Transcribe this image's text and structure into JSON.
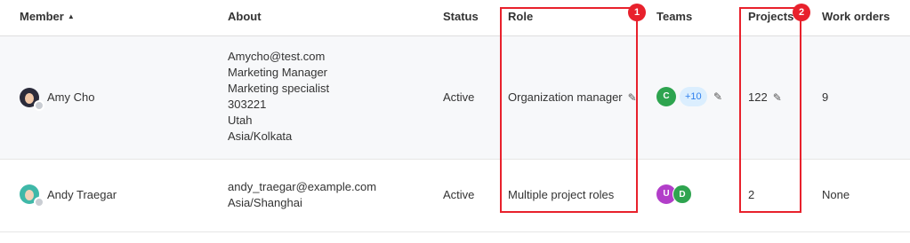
{
  "columns": {
    "member": "Member",
    "about": "About",
    "status": "Status",
    "role": "Role",
    "teams": "Teams",
    "projects": "Projects",
    "work_orders": "Work orders"
  },
  "sort_indicator": "▲",
  "rows": [
    {
      "name": "Amy Cho",
      "about": [
        "Amycho@test.com",
        "Marketing Manager",
        "Marketing specialist",
        "303221",
        "Utah",
        "Asia/Kolkata"
      ],
      "status": "Active",
      "role": "Organization manager",
      "teams": [
        {
          "letter": "C",
          "color": "#2ea44f"
        }
      ],
      "teams_more": "+10",
      "projects": "122",
      "work_orders": "9"
    },
    {
      "name": "Andy Traegar",
      "about": [
        "andy_traegar@example.com",
        "Asia/Shanghai"
      ],
      "status": "Active",
      "role": "Multiple project roles",
      "teams": [
        {
          "letter": "U",
          "color": "#b23ec9"
        },
        {
          "letter": "D",
          "color": "#2ea44f"
        }
      ],
      "projects": "2",
      "work_orders": "None"
    }
  ],
  "highlights": [
    {
      "number": "1",
      "color": "#e8212c"
    },
    {
      "number": "2",
      "color": "#e8212c"
    }
  ],
  "icons": {
    "edit": "pencil-icon",
    "sort": "sort-ascending-icon"
  }
}
